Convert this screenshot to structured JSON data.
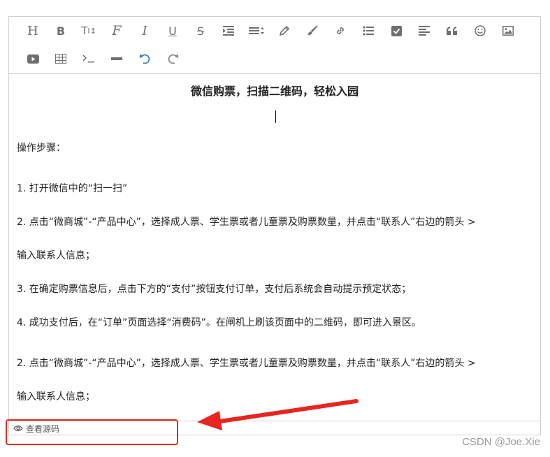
{
  "toolbar": {
    "row1": [
      {
        "name": "heading-icon",
        "glyph": "H"
      },
      {
        "name": "bold-icon",
        "glyph": "B"
      },
      {
        "name": "font-size-icon",
        "glyph": "TT"
      },
      {
        "name": "font-family-icon",
        "glyph": "F"
      },
      {
        "name": "italic-icon",
        "glyph": "I"
      },
      {
        "name": "underline-icon",
        "glyph": "U"
      },
      {
        "name": "strikethrough-icon",
        "glyph": "S"
      },
      {
        "name": "indent-icon",
        "glyph": ""
      },
      {
        "name": "line-height-icon",
        "glyph": ""
      },
      {
        "name": "pen-icon",
        "glyph": ""
      },
      {
        "name": "brush-icon",
        "glyph": ""
      },
      {
        "name": "link-icon",
        "glyph": ""
      },
      {
        "name": "list-icon",
        "glyph": ""
      },
      {
        "name": "checkbox-icon",
        "glyph": ""
      },
      {
        "name": "align-icon",
        "glyph": ""
      },
      {
        "name": "quote-icon",
        "glyph": "❝"
      },
      {
        "name": "emoji-icon",
        "glyph": ""
      },
      {
        "name": "image-icon",
        "glyph": ""
      }
    ],
    "row2": [
      {
        "name": "video-icon",
        "glyph": ""
      },
      {
        "name": "table-icon",
        "glyph": ""
      },
      {
        "name": "code-icon",
        "glyph": ">_"
      },
      {
        "name": "divider-icon",
        "glyph": ""
      },
      {
        "name": "undo-icon",
        "glyph": ""
      },
      {
        "name": "redo-icon",
        "glyph": ""
      }
    ],
    "accent_color": "#3b82c4"
  },
  "content": {
    "title": "微信购票，扫描二维码，轻松入园",
    "steps_heading": "操作步骤：",
    "lines": [
      "1. 打开微信中的“扫一扫”",
      "2. 点击“微商城”-“产品中心”，选择成人票、学生票或者儿童票及购票数量，并点击“联系人”右边的箭头 >",
      "输入联系人信息；",
      "3. 在确定购票信息后，点击下方的“支付”按钮支付订单，支付后系统会自动提示预定状态；",
      "4. 成功支付后，在“订单”页面选择“消费码”。在闸机上刷该页面中的二维码，即可进入景区。",
      "2. 点击“微商城”-“产品中心”，选择成人票、学生票或者儿童票及购票数量，并点击“联系人”右边的箭头 >",
      "输入联系人信息；"
    ]
  },
  "footer": {
    "view_source_label": "查看源码"
  },
  "annotation": {
    "color": "#e8251f"
  },
  "watermark": "CSDN @Joe.Xie"
}
